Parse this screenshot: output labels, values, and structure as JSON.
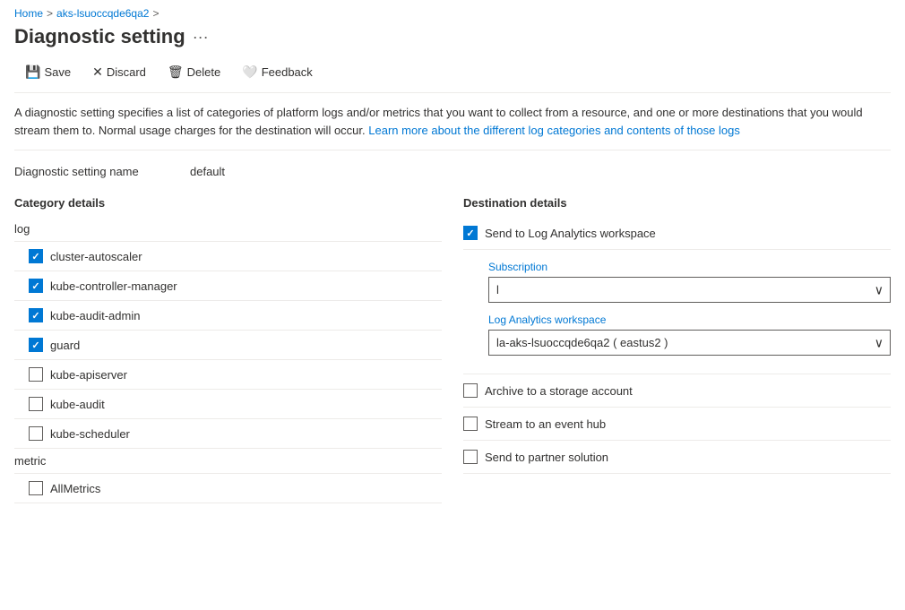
{
  "breadcrumb": {
    "home": "Home",
    "resource": "aks-lsuoccqde6qa2",
    "separator": ">"
  },
  "page": {
    "title": "Diagnostic setting",
    "more_icon": "···"
  },
  "toolbar": {
    "save": "Save",
    "discard": "Discard",
    "delete": "Delete",
    "feedback": "Feedback"
  },
  "description": {
    "text1": "A diagnostic setting specifies a list of categories of platform logs and/or metrics that you want to collect from a resource, and one or more destinations that you would stream them to. Normal usage charges for the destination will occur. ",
    "link_text": "Learn more about the different log categories and contents of those logs",
    "text2": ""
  },
  "setting_name": {
    "label": "Diagnostic setting name",
    "value": "default"
  },
  "category_details": {
    "title": "Category details",
    "log_header": "log",
    "items": [
      {
        "id": "cluster-autoscaler",
        "label": "cluster-autoscaler",
        "checked": true
      },
      {
        "id": "kube-controller-manager",
        "label": "kube-controller-manager",
        "checked": true
      },
      {
        "id": "kube-audit-admin",
        "label": "kube-audit-admin",
        "checked": true
      },
      {
        "id": "guard",
        "label": "guard",
        "checked": true
      },
      {
        "id": "kube-apiserver",
        "label": "kube-apiserver",
        "checked": false
      },
      {
        "id": "kube-audit",
        "label": "kube-audit",
        "checked": false
      },
      {
        "id": "kube-scheduler",
        "label": "kube-scheduler",
        "checked": false
      }
    ],
    "metric_header": "metric",
    "metric_items": [
      {
        "id": "AllMetrics",
        "label": "AllMetrics",
        "checked": false
      }
    ]
  },
  "destination_details": {
    "title": "Destination details",
    "send_to_log_analytics": {
      "label": "Send to Log Analytics workspace",
      "checked": true
    },
    "subscription": {
      "label": "Subscription",
      "value": "l",
      "options": [
        "l"
      ]
    },
    "log_analytics_workspace": {
      "label": "Log Analytics workspace",
      "value": "la-aks-lsuoccqde6qa2 ( eastus2 )",
      "options": [
        "la-aks-lsuoccqde6qa2 ( eastus2 )"
      ]
    },
    "archive_storage": {
      "label": "Archive to a storage account",
      "checked": false
    },
    "stream_event_hub": {
      "label": "Stream to an event hub",
      "checked": false
    },
    "partner_solution": {
      "label": "Send to partner solution",
      "checked": false
    }
  }
}
